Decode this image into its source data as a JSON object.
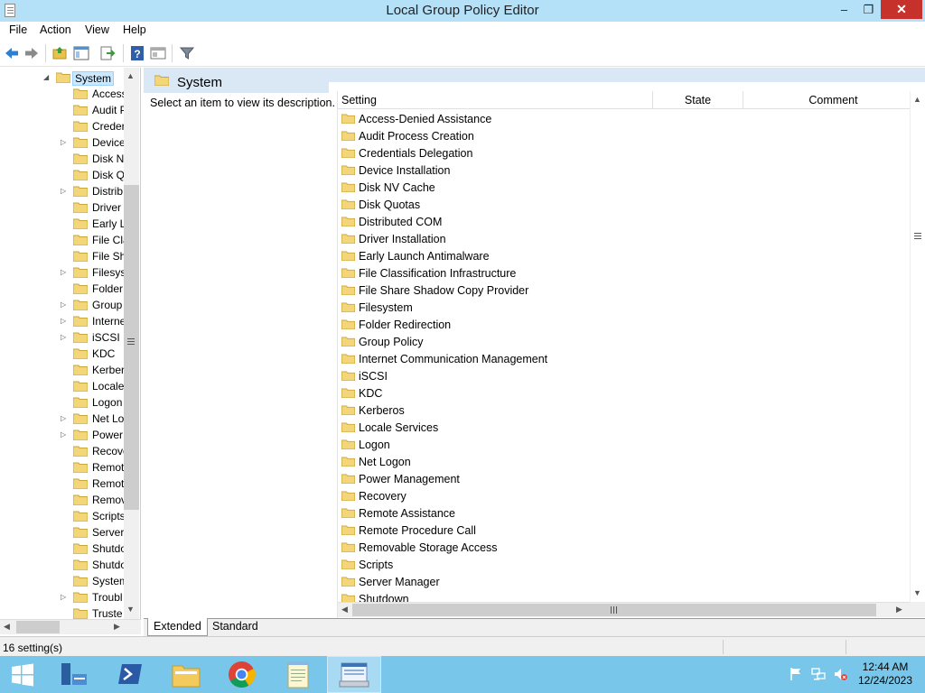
{
  "window": {
    "title": "Local Group Policy Editor",
    "controls": {
      "minimize": "‒",
      "maximize": "❐",
      "close": "✕"
    }
  },
  "menu": [
    "File",
    "Action",
    "View",
    "Help"
  ],
  "toolbar": {
    "buttons": [
      "back-icon",
      "forward-icon",
      "up-folder-icon",
      "show-hide-tree-icon",
      "export-list-icon",
      "help-icon",
      "properties-icon",
      "filter-icon"
    ]
  },
  "tree": {
    "root": {
      "label": "System",
      "expanded": true
    },
    "items": [
      {
        "label": "Access",
        "expandable": false
      },
      {
        "label": "Audit P",
        "expandable": false
      },
      {
        "label": "Creder",
        "expandable": false
      },
      {
        "label": "Device",
        "expandable": true
      },
      {
        "label": "Disk N",
        "expandable": false
      },
      {
        "label": "Disk Q",
        "expandable": false
      },
      {
        "label": "Distrib",
        "expandable": true
      },
      {
        "label": "Driver",
        "expandable": false
      },
      {
        "label": "Early L",
        "expandable": false
      },
      {
        "label": "File Cla",
        "expandable": false
      },
      {
        "label": "File Sh",
        "expandable": false
      },
      {
        "label": "Filesys",
        "expandable": true
      },
      {
        "label": "Folder",
        "expandable": false
      },
      {
        "label": "Group",
        "expandable": true
      },
      {
        "label": "Interne",
        "expandable": true
      },
      {
        "label": "iSCSI",
        "expandable": true
      },
      {
        "label": "KDC",
        "expandable": false
      },
      {
        "label": "Kerber",
        "expandable": false
      },
      {
        "label": "Locale",
        "expandable": false
      },
      {
        "label": "Logon",
        "expandable": false
      },
      {
        "label": "Net Lo",
        "expandable": true
      },
      {
        "label": "Power",
        "expandable": true
      },
      {
        "label": "Recove",
        "expandable": false
      },
      {
        "label": "Remot",
        "expandable": false
      },
      {
        "label": "Remot",
        "expandable": false
      },
      {
        "label": "Remov",
        "expandable": false
      },
      {
        "label": "Scripts",
        "expandable": false
      },
      {
        "label": "Server",
        "expandable": false
      },
      {
        "label": "Shutdo",
        "expandable": false
      },
      {
        "label": "Shutdo",
        "expandable": false
      },
      {
        "label": "System",
        "expandable": false
      },
      {
        "label": "Troubl",
        "expandable": true
      },
      {
        "label": "Truste",
        "expandable": false
      }
    ]
  },
  "main": {
    "header": "System",
    "description": "Select an item to view its description.",
    "columns": [
      "Setting",
      "State",
      "Comment"
    ],
    "rows": [
      "Access-Denied Assistance",
      "Audit Process Creation",
      "Credentials Delegation",
      "Device Installation",
      "Disk NV Cache",
      "Disk Quotas",
      "Distributed COM",
      "Driver Installation",
      "Early Launch Antimalware",
      "File Classification Infrastructure",
      "File Share Shadow Copy Provider",
      "Filesystem",
      "Folder Redirection",
      "Group Policy",
      "Internet Communication Management",
      "iSCSI",
      "KDC",
      "Kerberos",
      "Locale Services",
      "Logon",
      "Net Logon",
      "Power Management",
      "Recovery",
      "Remote Assistance",
      "Remote Procedure Call",
      "Removable Storage Access",
      "Scripts",
      "Server Manager",
      "Shutdown"
    ],
    "tabs": [
      "Extended",
      "Standard"
    ]
  },
  "status": {
    "text": "16 setting(s)"
  },
  "taskbar": {
    "apps": [
      "start-button",
      "server-manager-icon",
      "powershell-icon",
      "file-explorer-icon",
      "chrome-icon",
      "notepad-icon",
      "group-policy-editor-icon"
    ],
    "time": "12:44 AM",
    "date": "12/24/2023",
    "tray": [
      "flag-icon",
      "network-icon",
      "volume-muted-icon"
    ]
  },
  "colors": {
    "title_bar": "#b4e0f8",
    "close_button": "#c7312c",
    "folder": "#f3d67a",
    "selection": "#cce8ff",
    "taskbar": "#79c6eb"
  }
}
